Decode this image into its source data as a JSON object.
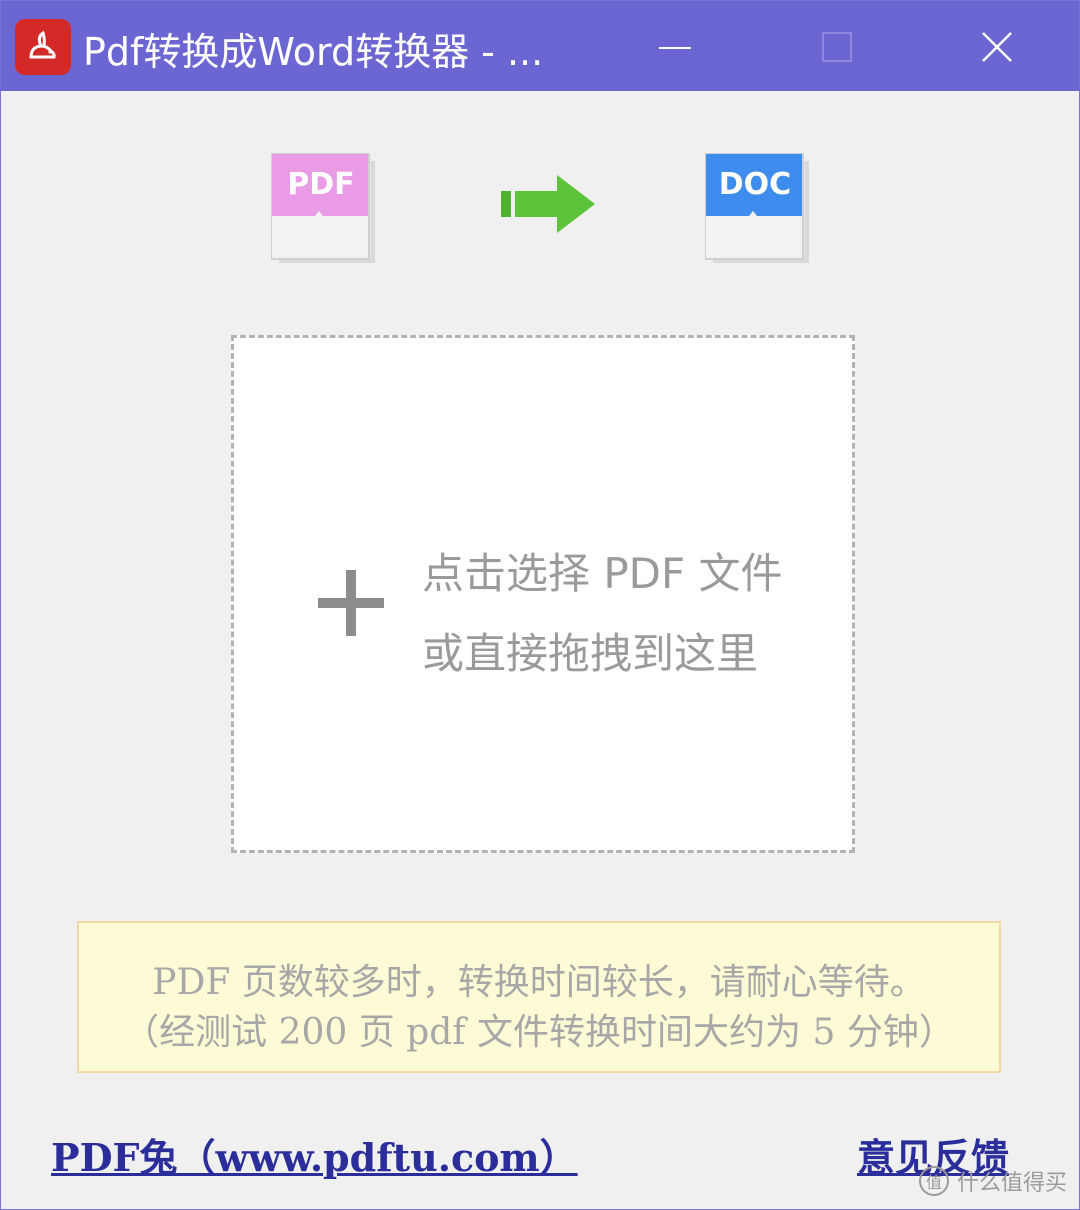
{
  "window": {
    "title": "Pdf转换成Word转换器 - ..."
  },
  "header_icons": {
    "pdf_label": "PDF",
    "doc_label": "DOC",
    "pdf_color": "#e99be6",
    "doc_color": "#3f8cef",
    "arrow_color": "#5cc43a"
  },
  "dropzone": {
    "line1": "点击选择 PDF 文件",
    "line2": "或直接拖拽到这里"
  },
  "notice": {
    "line1": "PDF 页数较多时，转换时间较长，请耐心等待。",
    "line2": "（经测试 200 页 pdf 文件转换时间大约为 5 分钟）"
  },
  "footer": {
    "site_link": "PDF兔（www.pdftu.com）",
    "feedback_link": "意见反馈"
  },
  "watermark": {
    "text": "什么值得买",
    "badge": "值"
  },
  "colors": {
    "titlebar": "#6b66d2",
    "link": "#2a2d9a",
    "notice_bg": "#fdfbd6"
  }
}
